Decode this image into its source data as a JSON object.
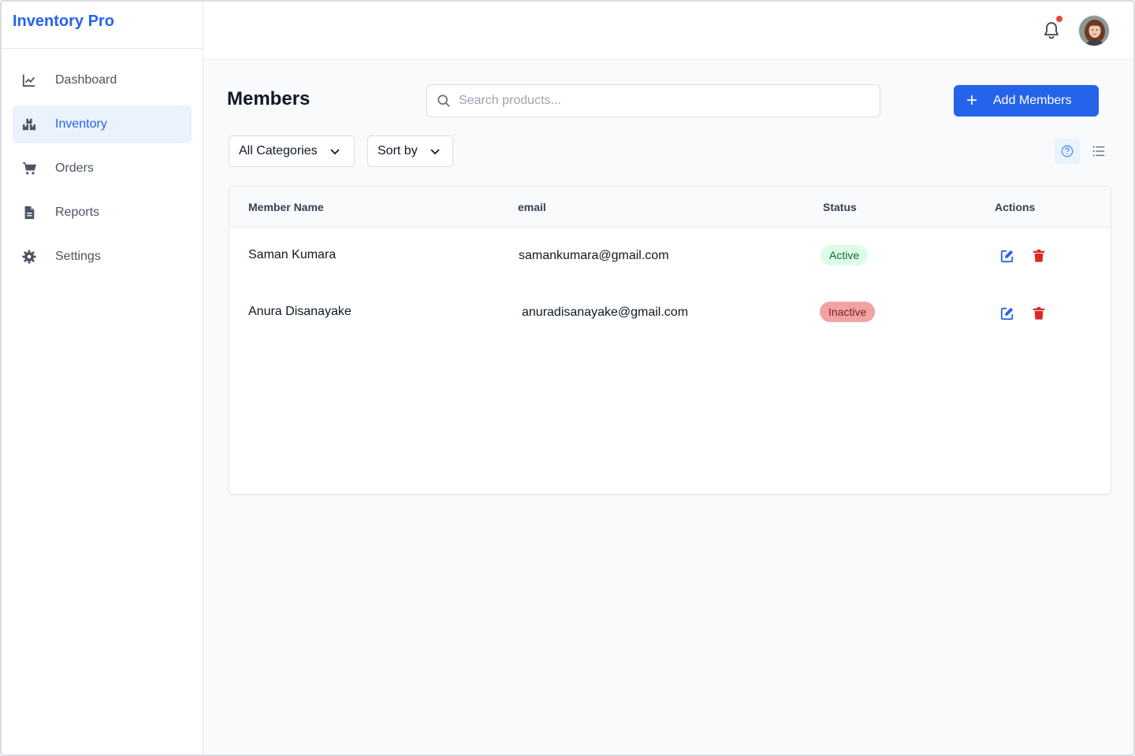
{
  "brand": {
    "name": "Inventory Pro"
  },
  "sidebar": {
    "items": [
      {
        "label": "Dashboard",
        "icon": "chart-line-icon"
      },
      {
        "label": "Inventory",
        "icon": "boxes-icon",
        "active": true
      },
      {
        "label": "Orders",
        "icon": "cart-icon"
      },
      {
        "label": "Reports",
        "icon": "file-icon"
      },
      {
        "label": "Settings",
        "icon": "gear-icon"
      }
    ]
  },
  "topbar": {
    "notification_icon": "bell-icon",
    "has_unread": true,
    "avatar": "user-avatar"
  },
  "main": {
    "title": "Members",
    "search": {
      "placeholder": "Search products...",
      "value": ""
    },
    "add_button": {
      "label": "Add Members",
      "icon": "plus-icon"
    },
    "filters": {
      "category": "All Categories",
      "sort": "Sort by"
    },
    "view_toggles": [
      "grid-view-icon",
      "list-view-icon"
    ]
  },
  "table": {
    "columns": [
      "Member Name",
      "email",
      "Status",
      "Actions"
    ],
    "rows": [
      {
        "name": "Saman Kumara",
        "email": "samankumara@gmail.com",
        "status": "Active"
      },
      {
        "name": "Anura Disanayake",
        "email": "anuradisanayake@gmail.com",
        "status": "Inactive"
      }
    ]
  },
  "colors": {
    "accent": "#2563eb",
    "active_badge_bg": "#dcfce7",
    "inactive_badge_bg": "#f1a3a3",
    "delete_red": "#dc2626"
  }
}
